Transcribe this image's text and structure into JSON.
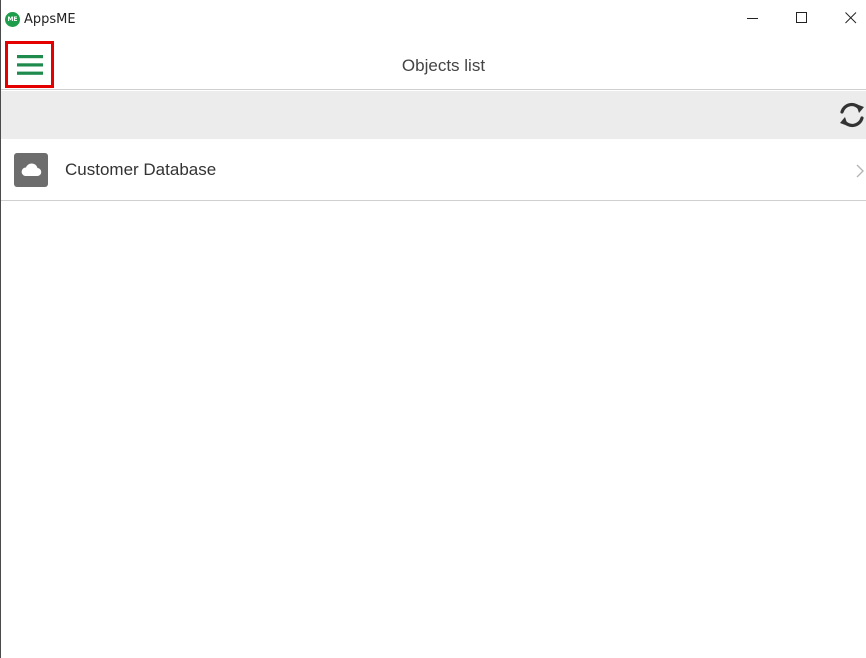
{
  "window": {
    "app_title": "AppsME",
    "logo_text": "ME",
    "controls": {
      "minimize": "minimize-icon",
      "maximize": "maximize-icon",
      "close": "close-icon"
    }
  },
  "appbar": {
    "title": "Objects list",
    "menu_icon": "hamburger-menu-icon",
    "menu_icon_color": "#1e8a4c",
    "highlight_color": "#e50000"
  },
  "toolbar": {
    "refresh_icon": "refresh-icon"
  },
  "list": {
    "items": [
      {
        "label": "Customer Database",
        "icon": "cloud-icon",
        "trailing_icon": "chevron-right-icon"
      }
    ]
  }
}
